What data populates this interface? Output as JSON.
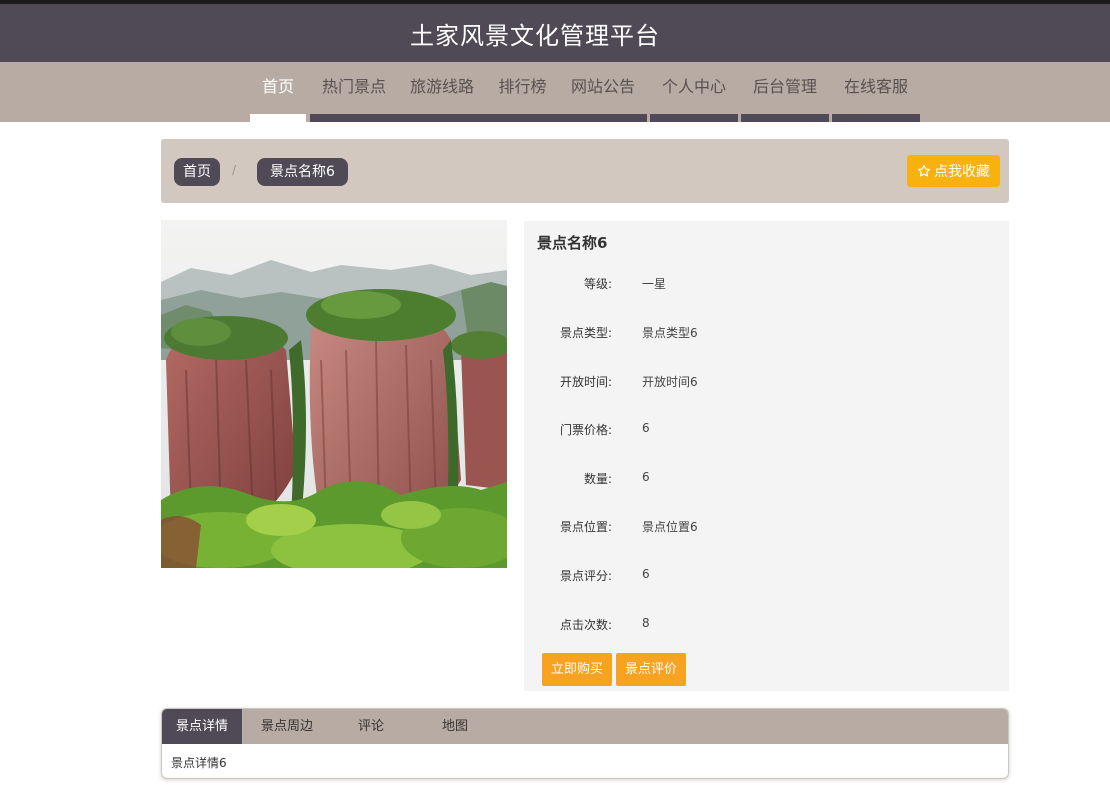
{
  "header": {
    "title": "土家风景文化管理平台"
  },
  "nav": {
    "items": [
      {
        "label": "首页"
      },
      {
        "label": "热门景点"
      },
      {
        "label": "旅游线路"
      },
      {
        "label": "排行榜"
      },
      {
        "label": "网站公告"
      },
      {
        "label": "个人中心"
      },
      {
        "label": "后台管理"
      },
      {
        "label": "在线客服"
      }
    ],
    "active_index": 0
  },
  "breadcrumb": {
    "home": "首页",
    "separator": "/",
    "current": "景点名称6"
  },
  "favorite_button": {
    "icon": "star-outline-icon",
    "label": "点我收藏"
  },
  "detail": {
    "title": "景点名称6",
    "fields": [
      {
        "label": "等级:",
        "value": "一星"
      },
      {
        "label": "景点类型:",
        "value": "景点类型6"
      },
      {
        "label": "开放时间:",
        "value": "开放时间6"
      },
      {
        "label": "门票价格:",
        "value": "6"
      },
      {
        "label": "数量:",
        "value": "6"
      },
      {
        "label": "景点位置:",
        "value": "景点位置6"
      },
      {
        "label": "景点评分:",
        "value": "6"
      },
      {
        "label": "点击次数:",
        "value": "8"
      }
    ],
    "buy_button": "立即购买",
    "review_button": "景点评价"
  },
  "tabs": {
    "items": [
      "景点详情",
      "景点周边",
      "评论",
      "地图"
    ],
    "active_index": 0,
    "content": "景点详情6"
  },
  "colors": {
    "header_bg": "#4f4a55",
    "nav_bg": "#b7aba3",
    "breadcrumb_bg": "#d2c8c0",
    "favorite_btn": "#f7b20f",
    "action_btn": "#f7a220",
    "panel_bg": "#f4f4f4"
  }
}
